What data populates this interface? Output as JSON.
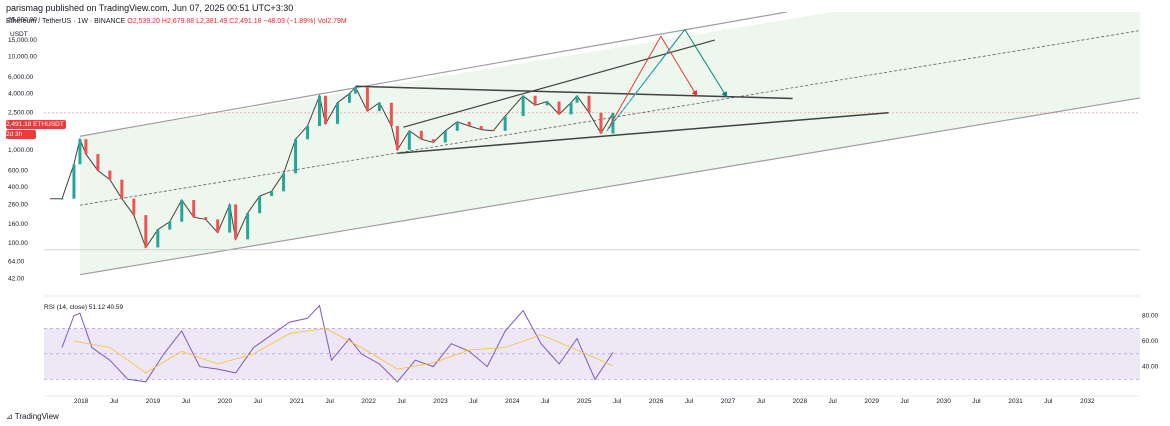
{
  "header": {
    "published": "parismag published on TradingView.com, Jun 07, 2025 00:51 UTC+3:30",
    "symbol": "Ethereum / TetherUS · 1W · BINANCE",
    "ohlc": "O2,539.20 H2,679.88 L2,381.49 C2,491.18 −48.03 (−1.89%) Vol2.79M",
    "unit": "USDT"
  },
  "price_label": {
    "value": "2,491.18",
    "ticker": "ETHUSDT",
    "countdown": "2d 3h"
  },
  "rsi_label": "RSI (14, close)  51.12  40.59",
  "footer": "TradingView",
  "colors": {
    "up": "#26a69a",
    "down": "#ef5350",
    "channel_fill": "#e8f5e9",
    "rsi_fill": "#ede7f6",
    "rsi_line": "#7e57c2",
    "rsi_ma": "#fbc02d",
    "arrow_red": "#e53935",
    "arrow_teal": "#00897b",
    "current_price_line": "#e57373"
  },
  "chart_data": [
    {
      "type": "line",
      "title": "Ethereum / TetherUS · 1W · BINANCE",
      "ylabel": "USDT",
      "yscale": "log",
      "ylim": [
        30,
        30000
      ],
      "y_ticks": [
        25000,
        15000,
        10000,
        6000,
        4000,
        2500,
        1500,
        1000,
        600,
        400,
        260,
        160,
        100,
        64,
        42
      ],
      "y_tick_labels": [
        "25,000.00",
        "15,000.00",
        "10,000.00",
        "6,000.00",
        "4,000.00",
        "2,500.00",
        "1,500.00",
        "1,000.00",
        "600.00",
        "400.00",
        "260.00",
        "160.00",
        "100.00",
        "64.00",
        "42.00"
      ],
      "x_tick_labels": [
        "2018",
        "Jul",
        "2019",
        "Jul",
        "2020",
        "Jul",
        "2021",
        "Jul",
        "2022",
        "Jul",
        "2023",
        "Jul",
        "2024",
        "Jul",
        "2025",
        "Jul",
        "2026",
        "Jul",
        "2027",
        "Jul",
        "2028",
        "Jul",
        "2029",
        "Jul",
        "2030",
        "Jul",
        "2031",
        "Jul",
        "2032"
      ],
      "last_price": 2491.18,
      "series": [
        {
          "name": "ETHUSDT",
          "points": [
            [
              "2017-08",
              300
            ],
            [
              "2017-10",
              300
            ],
            [
              "2017-12",
              700
            ],
            [
              "2018-01",
              1300
            ],
            [
              "2018-02",
              900
            ],
            [
              "2018-04",
              600
            ],
            [
              "2018-06",
              480
            ],
            [
              "2018-08",
              300
            ],
            [
              "2018-10",
              200
            ],
            [
              "2018-12",
              90
            ],
            [
              "2019-02",
              140
            ],
            [
              "2019-04",
              170
            ],
            [
              "2019-06",
              290
            ],
            [
              "2019-08",
              190
            ],
            [
              "2019-10",
              180
            ],
            [
              "2019-12",
              130
            ],
            [
              "2020-02",
              260
            ],
            [
              "2020-03",
              110
            ],
            [
              "2020-05",
              210
            ],
            [
              "2020-07",
              320
            ],
            [
              "2020-09",
              360
            ],
            [
              "2020-11",
              560
            ],
            [
              "2021-01",
              1300
            ],
            [
              "2021-03",
              1800
            ],
            [
              "2021-05",
              3800
            ],
            [
              "2021-06",
              1900
            ],
            [
              "2021-08",
              3200
            ],
            [
              "2021-10",
              4000
            ],
            [
              "2021-11",
              4700
            ],
            [
              "2022-01",
              2600
            ],
            [
              "2022-03",
              3200
            ],
            [
              "2022-05",
              1800
            ],
            [
              "2022-06",
              1000
            ],
            [
              "2022-08",
              1600
            ],
            [
              "2022-10",
              1300
            ],
            [
              "2022-12",
              1200
            ],
            [
              "2023-02",
              1600
            ],
            [
              "2023-04",
              2000
            ],
            [
              "2023-06",
              1800
            ],
            [
              "2023-08",
              1650
            ],
            [
              "2023-10",
              1600
            ],
            [
              "2023-12",
              2300
            ],
            [
              "2024-03",
              3800
            ],
            [
              "2024-05",
              3000
            ],
            [
              "2024-07",
              3300
            ],
            [
              "2024-09",
              2400
            ],
            [
              "2024-11",
              3200
            ],
            [
              "2024-12",
              3800
            ],
            [
              "2025-02",
              2500
            ],
            [
              "2025-04",
              1500
            ],
            [
              "2025-06",
              2491.18
            ]
          ]
        }
      ],
      "annotations": [
        "ascending channel",
        "channel midline (dashed)",
        "triangle",
        "projection arrows (red, teal)"
      ]
    },
    {
      "type": "line",
      "title": "RSI (14, close)",
      "ylim": [
        20,
        90
      ],
      "y_ticks": [
        80,
        60,
        40
      ],
      "y_tick_labels": [
        "80.00",
        "60.00",
        "40.00"
      ],
      "bands": [
        30,
        70
      ],
      "series": [
        {
          "name": "RSI",
          "points": [
            [
              "2017-10",
              55
            ],
            [
              "2017-12",
              80
            ],
            [
              "2018-01",
              82
            ],
            [
              "2018-03",
              55
            ],
            [
              "2018-06",
              45
            ],
            [
              "2018-09",
              30
            ],
            [
              "2018-12",
              28
            ],
            [
              "2019-03",
              50
            ],
            [
              "2019-06",
              68
            ],
            [
              "2019-09",
              40
            ],
            [
              "2019-12",
              38
            ],
            [
              "2020-03",
              35
            ],
            [
              "2020-06",
              55
            ],
            [
              "2020-09",
              65
            ],
            [
              "2020-12",
              75
            ],
            [
              "2021-03",
              78
            ],
            [
              "2021-05",
              88
            ],
            [
              "2021-07",
              45
            ],
            [
              "2021-10",
              62
            ],
            [
              "2021-12",
              50
            ],
            [
              "2022-03",
              42
            ],
            [
              "2022-06",
              28
            ],
            [
              "2022-09",
              45
            ],
            [
              "2022-12",
              40
            ],
            [
              "2023-03",
              58
            ],
            [
              "2023-06",
              52
            ],
            [
              "2023-09",
              40
            ],
            [
              "2023-12",
              68
            ],
            [
              "2024-03",
              84
            ],
            [
              "2024-06",
              58
            ],
            [
              "2024-09",
              42
            ],
            [
              "2024-12",
              62
            ],
            [
              "2025-03",
              30
            ],
            [
              "2025-06",
              51.12
            ]
          ]
        },
        {
          "name": "RSI-based MA",
          "points": [
            [
              "2017-12",
              60
            ],
            [
              "2018-06",
              55
            ],
            [
              "2018-12",
              35
            ],
            [
              "2019-06",
              52
            ],
            [
              "2019-12",
              42
            ],
            [
              "2020-06",
              50
            ],
            [
              "2020-12",
              66
            ],
            [
              "2021-06",
              70
            ],
            [
              "2021-12",
              55
            ],
            [
              "2022-06",
              38
            ],
            [
              "2022-12",
              43
            ],
            [
              "2023-06",
              53
            ],
            [
              "2023-12",
              55
            ],
            [
              "2024-06",
              65
            ],
            [
              "2024-12",
              53
            ],
            [
              "2025-06",
              40.59
            ]
          ]
        }
      ]
    }
  ]
}
